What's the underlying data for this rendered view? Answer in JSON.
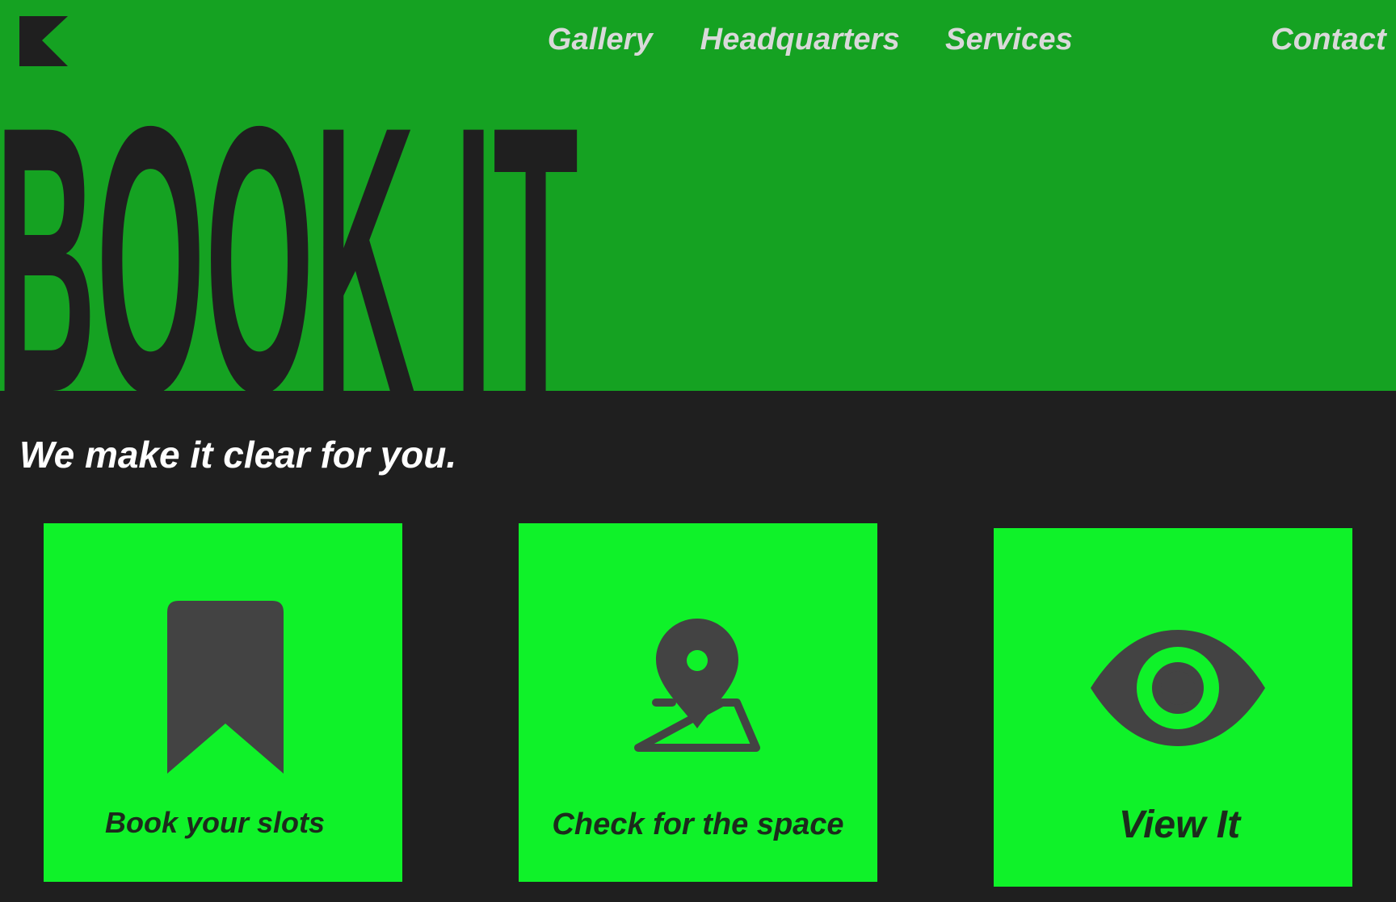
{
  "colors": {
    "hero_bg": "#15a222",
    "dark_bg": "#1f1f1f",
    "card_bg": "#0ff229",
    "icon": "#434343",
    "nav_text": "#d9d9d9"
  },
  "logo": {
    "icon": "k-logo-icon"
  },
  "nav": {
    "items": [
      {
        "label": "Gallery"
      },
      {
        "label": "Headquarters"
      },
      {
        "label": "Services"
      },
      {
        "label": "Contact"
      }
    ]
  },
  "hero": {
    "headline": "BOOK IT"
  },
  "tagline": "We make it clear for you.",
  "cards": [
    {
      "label": "Book your slots",
      "icon": "bookmark-icon"
    },
    {
      "label": "Check for the space",
      "icon": "map-pin-icon"
    },
    {
      "label": "View It",
      "icon": "eye-icon"
    }
  ]
}
